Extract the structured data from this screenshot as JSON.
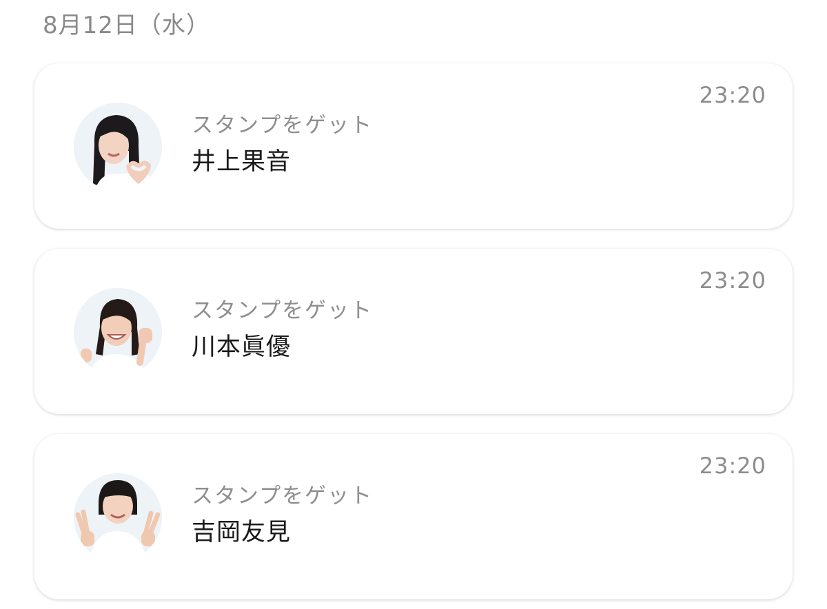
{
  "header": {
    "date_label": "8月12日（水）"
  },
  "notifications": [
    {
      "time": "23:20",
      "subtitle": "スタンプをゲット",
      "name": "井上果音",
      "avatar_icon": "member-photo-heart-pose"
    },
    {
      "time": "23:20",
      "subtitle": "スタンプをゲット",
      "name": "川本眞優",
      "avatar_icon": "member-photo-fist-pose"
    },
    {
      "time": "23:20",
      "subtitle": "スタンプをゲット",
      "name": "吉岡友見",
      "avatar_icon": "member-photo-peace-pose"
    }
  ],
  "colors": {
    "background": "#ffffff",
    "card_background": "#ffffff",
    "secondary_text": "#8e8e8e",
    "primary_text": "#1a1a1a"
  }
}
